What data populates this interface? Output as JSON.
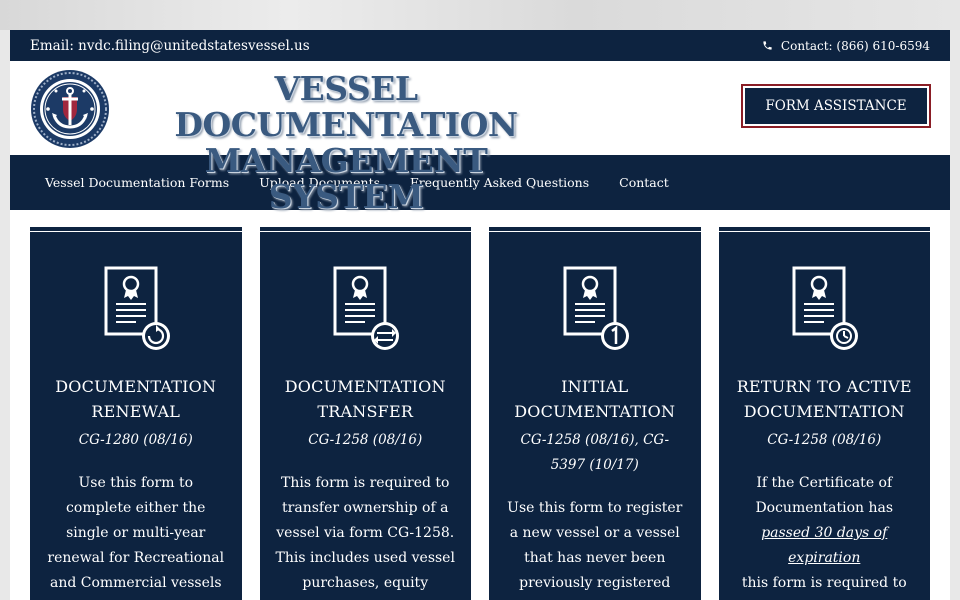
{
  "topbar": {
    "email": "Email: nvdc.filing@unitedstatesvessel.us",
    "contact": "Contact: (866) 610-6594"
  },
  "header": {
    "title_line1": "VESSEL DOCUMENTATION",
    "title_line2": "MANAGEMENT SYSTEM",
    "form_assistance": "FORM ASSISTANCE"
  },
  "nav": {
    "items": [
      {
        "label": "Vessel Documentation Forms"
      },
      {
        "label": "Upload Documents"
      },
      {
        "label": "Frequently Asked Questions"
      },
      {
        "label": "Contact"
      }
    ]
  },
  "cards": [
    {
      "title_line1": "DOCUMENTATION",
      "title_line2": "RENEWAL",
      "code": "CG-1280 (08/16)",
      "desc": "Use this form to complete either the single or multi-year renewal for Recreational and Commercial vessels"
    },
    {
      "title_line1": "DOCUMENTATION",
      "title_line2": "TRANSFER",
      "code": "CG-1258 (08/16)",
      "desc": "This form is required to transfer ownership of a vessel via form CG-1258. This includes used vessel purchases, equity transfer,"
    },
    {
      "title_line1": "INITIAL",
      "title_line2": "DOCUMENTATION",
      "code": "CG-1258 (08/16), CG-5397 (10/17)",
      "desc": "Use this form to register a new vessel or a vessel that has never been previously registered with the United"
    },
    {
      "title_line1": "RETURN TO ACTIVE",
      "title_line2": "DOCUMENTATION",
      "code": "CG-1258 (08/16)",
      "desc_pre": "If the Certificate of Documentation has",
      "desc_em": "passed 30 days of expiration",
      "desc_post": "this form is required to"
    }
  ],
  "colors": {
    "navy": "#0d2340",
    "title_blue": "#3a5a80",
    "button_border": "#8a1d25"
  }
}
